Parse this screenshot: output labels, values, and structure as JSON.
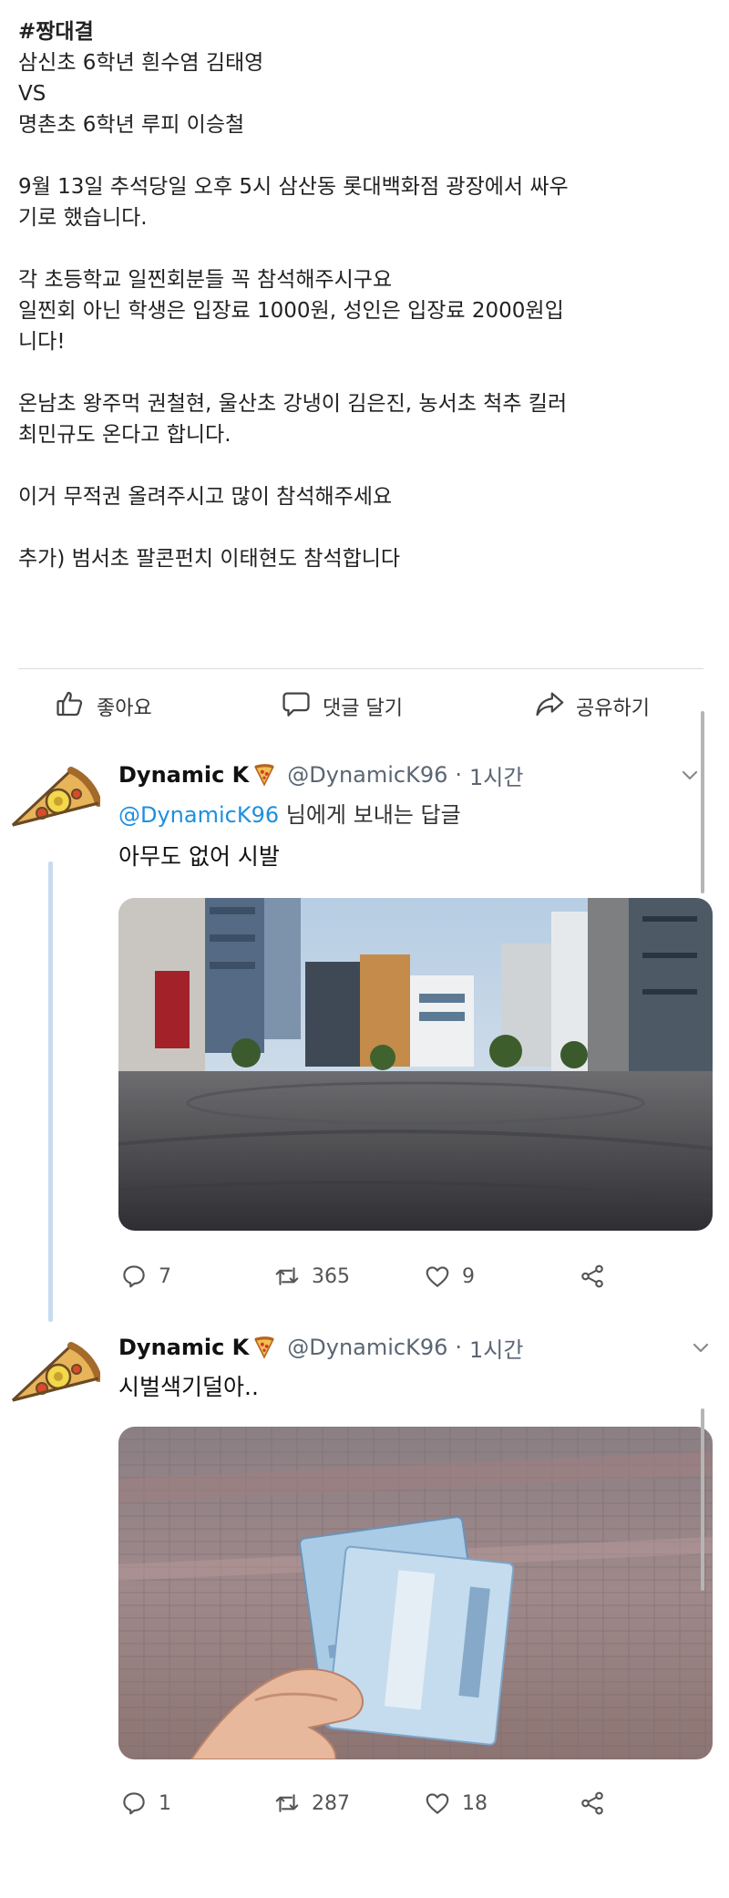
{
  "post": {
    "hashtag": "#짱대결",
    "fighter1": "삼신초 6학년 흰수염 김태영",
    "vs": "VS",
    "fighter2": "명촌초 6학년 루피 이승철",
    "line1": "9월 13일 추석당일 오후 5시 삼산동 롯대백화점 광장에서 싸우",
    "line2": "기로 했습니다.",
    "line3": "각 초등학교 일찐회분들 꼭 참석해주시구요",
    "line4": "일찐회 아닌 학생은 입장료 1000원, 성인은 입장료 2000원입",
    "line5": "니다!",
    "line6": "온남초 왕주먹 권철현, 울산초 강냉이 김은진, 농서초 척추 킬러",
    "line7": "최민규도 온다고 합니다.",
    "line8": "이거 무적권 올려주시고 많이 참석해주세요",
    "line9": "추가) 범서초 팔콘펀치 이태현도 참석합니다"
  },
  "actions": {
    "like": "좋아요",
    "comment": "댓글 달기",
    "share": "공유하기"
  },
  "tweets": [
    {
      "name": "Dynamic K",
      "handle": "@DynamicK96",
      "sep": "·",
      "time": "1시간",
      "reply_mention": "@DynamicK96",
      "reply_suffix": " 님에게 보내는 답글",
      "text": "아무도 없어 시발",
      "replies": "7",
      "retweets": "365",
      "likes": "9"
    },
    {
      "name": "Dynamic K",
      "handle": "@DynamicK96",
      "sep": "·",
      "time": "1시간",
      "text": "시벌색기덜아..",
      "replies": "1",
      "retweets": "287",
      "likes": "18"
    }
  ],
  "icons": {
    "like": "thumbs-up-icon",
    "comment": "speech-bubble-icon",
    "share": "share-arrow-icon",
    "reply": "reply-icon",
    "retweet": "retweet-icon",
    "heart": "heart-icon",
    "tweet_share": "share-nodes-icon",
    "more": "chevron-down-icon",
    "emoji": "pizza-icon"
  },
  "colors": {
    "mention": "#1d8fe0",
    "thread_line": "#c7dcef"
  }
}
